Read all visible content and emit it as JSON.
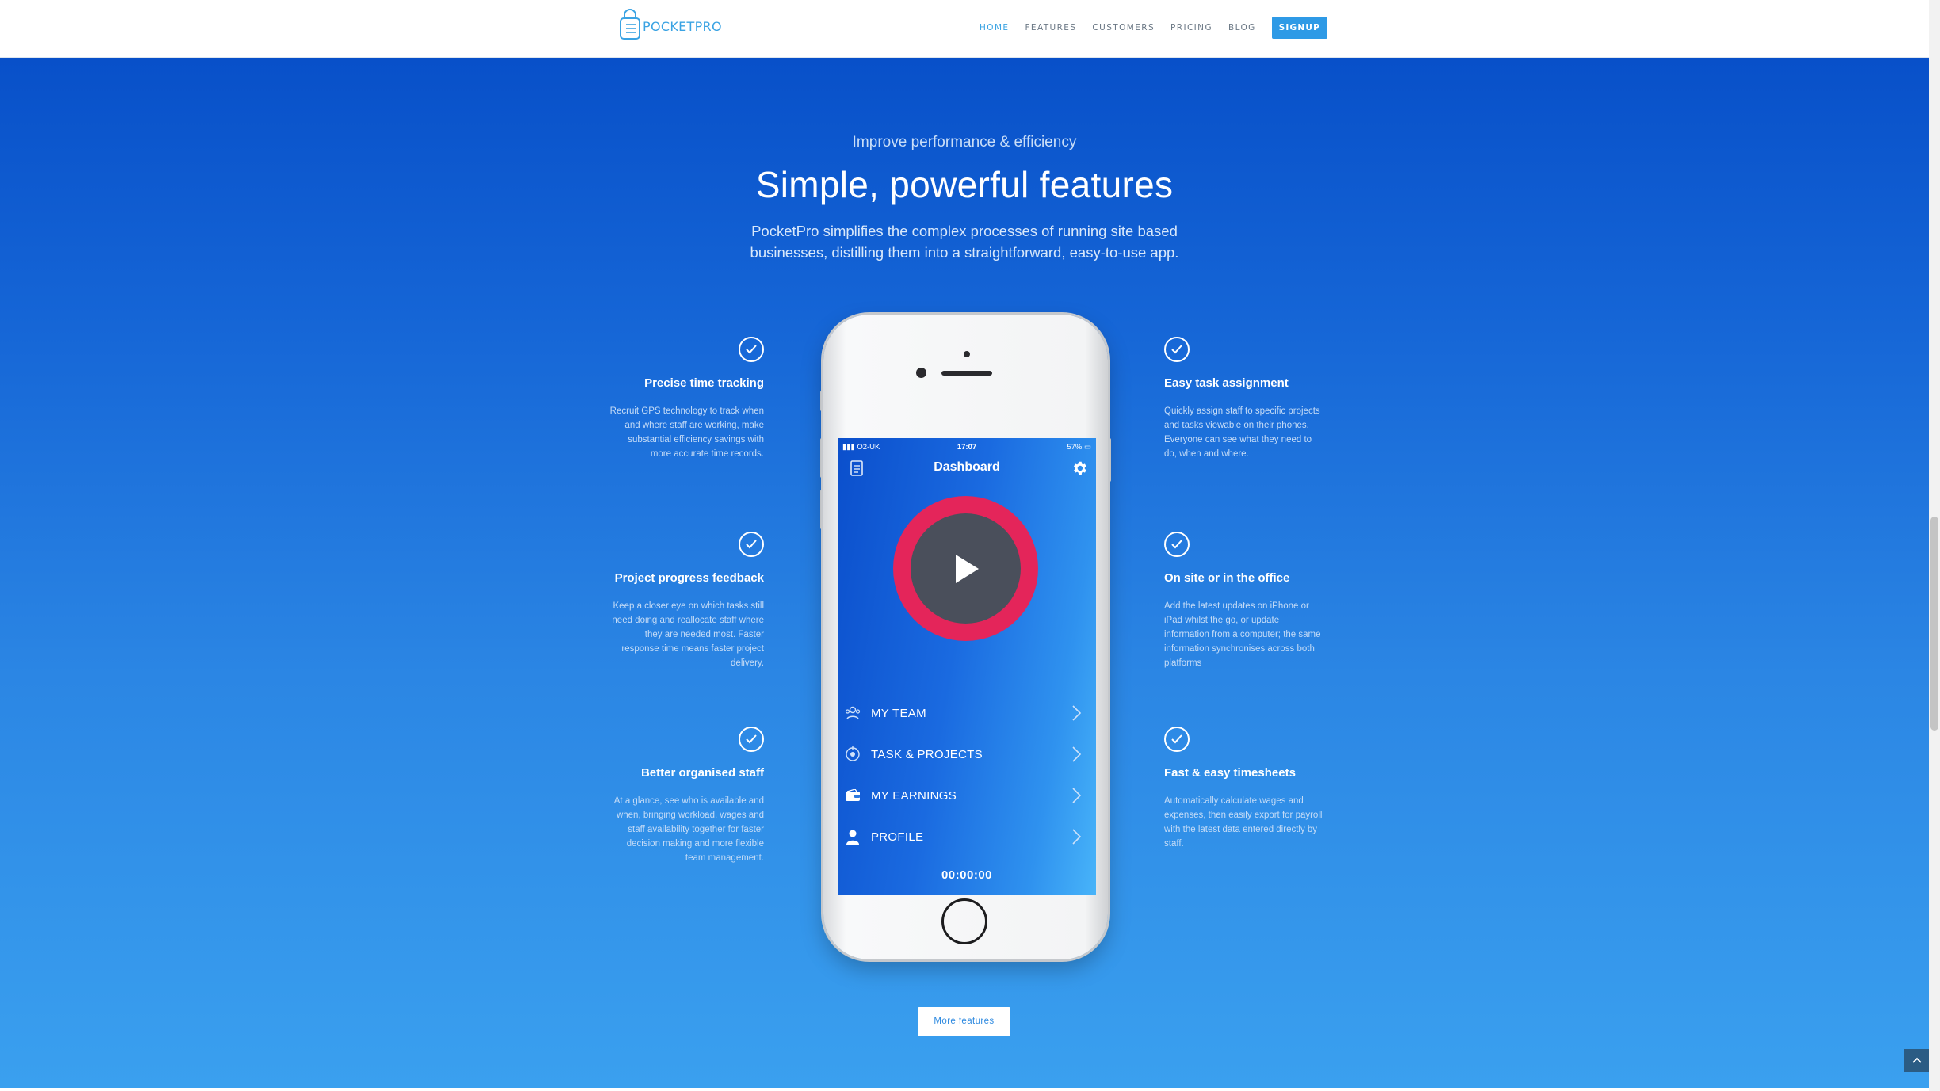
{
  "header": {
    "logo_text": "POCKETPRO",
    "nav": [
      {
        "label": "HOME",
        "active": true
      },
      {
        "label": "FEATURES"
      },
      {
        "label": "CUSTOMERS"
      },
      {
        "label": "PRICING"
      },
      {
        "label": "BLOG"
      }
    ],
    "signup_label": "SIGNUP"
  },
  "hero": {
    "eyebrow": "Improve performance & efficiency",
    "title": "Simple, powerful features",
    "description_line1": "PocketPro simplifies the complex processes of running site based",
    "description_line2": "businesses, distilling them into a straightforward, easy-to-use app."
  },
  "features_left": [
    {
      "title": "Precise time tracking",
      "text": "Recruit GPS technology to track when and where staff are working, make substantial efficiency savings with more accurate time records."
    },
    {
      "title": "Project progress feedback",
      "text": "Keep a closer eye on which tasks still need doing and reallocate staff where they are needed most. Faster response time means faster project delivery."
    },
    {
      "title": "Better organised staff",
      "text": "At a glance, see who is available and when, bringing workload, wages and staff availability together for faster decision making and more flexible team management."
    }
  ],
  "features_right": [
    {
      "title": "Easy task assignment",
      "text": "Quickly assign staff to specific projects and tasks viewable on their phones. Everyone can see what they need to do, when and where."
    },
    {
      "title": "On site or in the office",
      "text": "Add the latest updates on iPhone or iPad whilst the go, or update information from a computer; the same information synchronises across both platforms"
    },
    {
      "title": "Fast & easy timesheets",
      "text": "Automatically calculate wages and expenses, then easily export for payroll with the latest data entered directly by staff."
    }
  ],
  "phone": {
    "carrier": "O2-UK",
    "time": "17:07",
    "battery": "57%",
    "screen_title": "Dashboard",
    "menu": [
      {
        "label": "MY TEAM",
        "icon": "team-icon"
      },
      {
        "label": "TASK & PROJECTS",
        "icon": "projects-icon"
      },
      {
        "label": "MY EARNINGS",
        "icon": "wallet-icon"
      },
      {
        "label": "PROFILE",
        "icon": "user-icon"
      }
    ],
    "timer": "00:00:00"
  },
  "more_features_label": "More features",
  "colors": {
    "accent": "#2e9ae6",
    "gradient_top": "#0850c9",
    "gradient_bottom": "#3aa0ef",
    "play_ring": "#e4255a"
  }
}
